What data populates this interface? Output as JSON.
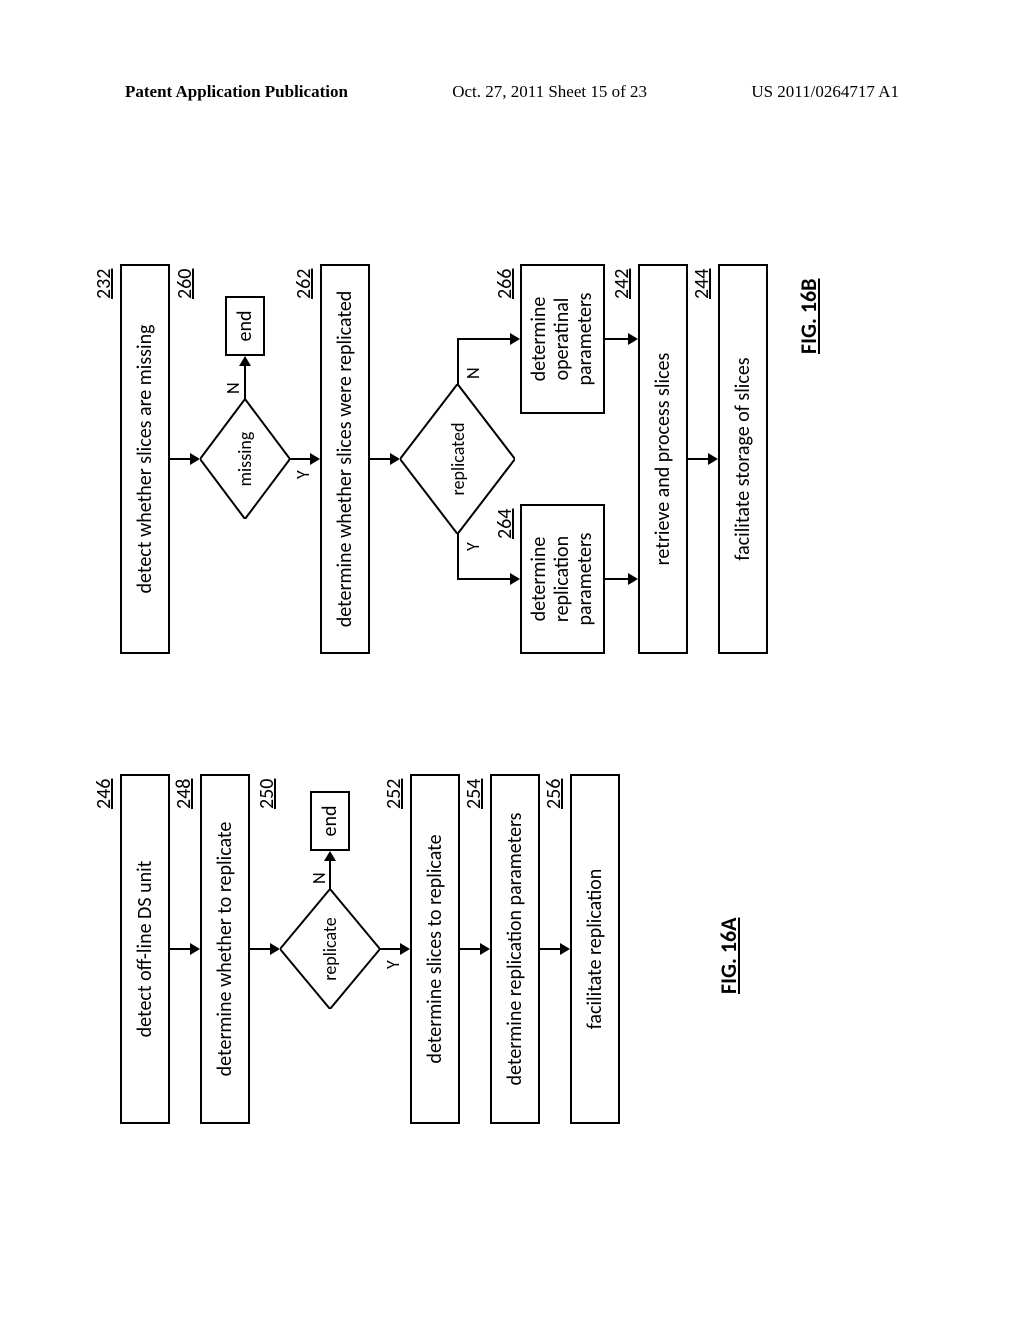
{
  "header": {
    "left": "Patent Application Publication",
    "center": "Oct. 27, 2011  Sheet 15 of 23",
    "right": "US 2011/0264717 A1"
  },
  "chart_data": [
    {
      "type": "flowchart",
      "title": "FIG. 16A",
      "nodes": [
        {
          "id": "246",
          "ref": "246",
          "text": "detect off-line DS unit",
          "shape": "rect"
        },
        {
          "id": "248",
          "ref": "248",
          "text": "determine whether to replicate",
          "shape": "rect"
        },
        {
          "id": "250",
          "ref": "250",
          "text": "replicate",
          "shape": "diamond",
          "branches": {
            "Y": "252",
            "N": "end1"
          }
        },
        {
          "id": "end1",
          "text": "end",
          "shape": "rect-small"
        },
        {
          "id": "252",
          "ref": "252",
          "text": "determine slices to replicate",
          "shape": "rect"
        },
        {
          "id": "254",
          "ref": "254",
          "text": "determine replication parameters",
          "shape": "rect"
        },
        {
          "id": "256",
          "ref": "256",
          "text": "facilitate replication",
          "shape": "rect"
        }
      ],
      "edges": [
        [
          "246",
          "248"
        ],
        [
          "248",
          "250"
        ],
        [
          "250",
          "252",
          "Y"
        ],
        [
          "250",
          "end1",
          "N"
        ],
        [
          "252",
          "254"
        ],
        [
          "254",
          "256"
        ]
      ]
    },
    {
      "type": "flowchart",
      "title": "FIG. 16B",
      "nodes": [
        {
          "id": "232",
          "ref": "232",
          "text": "detect whether slices are missing",
          "shape": "rect"
        },
        {
          "id": "260",
          "ref": "260",
          "text": "missing",
          "shape": "diamond",
          "branches": {
            "Y": "262",
            "N": "end2"
          }
        },
        {
          "id": "end2",
          "text": "end",
          "shape": "rect-small"
        },
        {
          "id": "262",
          "ref": "262",
          "text": "determine whether slices were replicated",
          "shape": "rect"
        },
        {
          "id": "repD",
          "text": "replicated",
          "shape": "diamond",
          "branches": {
            "Y": "264",
            "N": "266"
          }
        },
        {
          "id": "264",
          "ref": "264",
          "text": "determine replication parameters",
          "shape": "rect"
        },
        {
          "id": "266",
          "ref": "266",
          "text": "determine operatinal parameters",
          "shape": "rect"
        },
        {
          "id": "242",
          "ref": "242",
          "text": "retrieve and process slices",
          "shape": "rect"
        },
        {
          "id": "244",
          "ref": "244",
          "text": "facilitate storage of slices",
          "shape": "rect"
        }
      ],
      "edges": [
        [
          "232",
          "260"
        ],
        [
          "260",
          "262",
          "Y"
        ],
        [
          "260",
          "end2",
          "N"
        ],
        [
          "262",
          "repD"
        ],
        [
          "repD",
          "264",
          "Y"
        ],
        [
          "repD",
          "266",
          "N"
        ],
        [
          "264",
          "242"
        ],
        [
          "266",
          "242"
        ],
        [
          "242",
          "244"
        ]
      ]
    }
  ],
  "fig16a": {
    "ref246": "246",
    "box246": "detect off-line DS unit",
    "ref248": "248",
    "box248": "determine whether to replicate",
    "ref250": "250",
    "diamond250": "replicate",
    "end250": "end",
    "ref252": "252",
    "box252": "determine slices to replicate",
    "ref254": "254",
    "box254": "determine replication parameters",
    "ref256": "256",
    "box256": "facilitate replication",
    "label": "FIG. 16A",
    "Y": "Y",
    "N": "N"
  },
  "fig16b": {
    "ref232": "232",
    "box232": "detect whether slices are missing",
    "ref260": "260",
    "diamond260": "missing",
    "end260": "end",
    "ref262": "262",
    "box262": "determine whether slices were replicated",
    "diamondRep": "replicated",
    "ref264": "264",
    "box264": "determine\nreplication\nparameters",
    "ref266": "266",
    "box266": "determine\noperatinal\nparameters",
    "ref242": "242",
    "box242": "retrieve and process slices",
    "ref244": "244",
    "box244": "facilitate storage of slices",
    "label": "FIG. 16B",
    "Y": "Y",
    "N": "N"
  }
}
